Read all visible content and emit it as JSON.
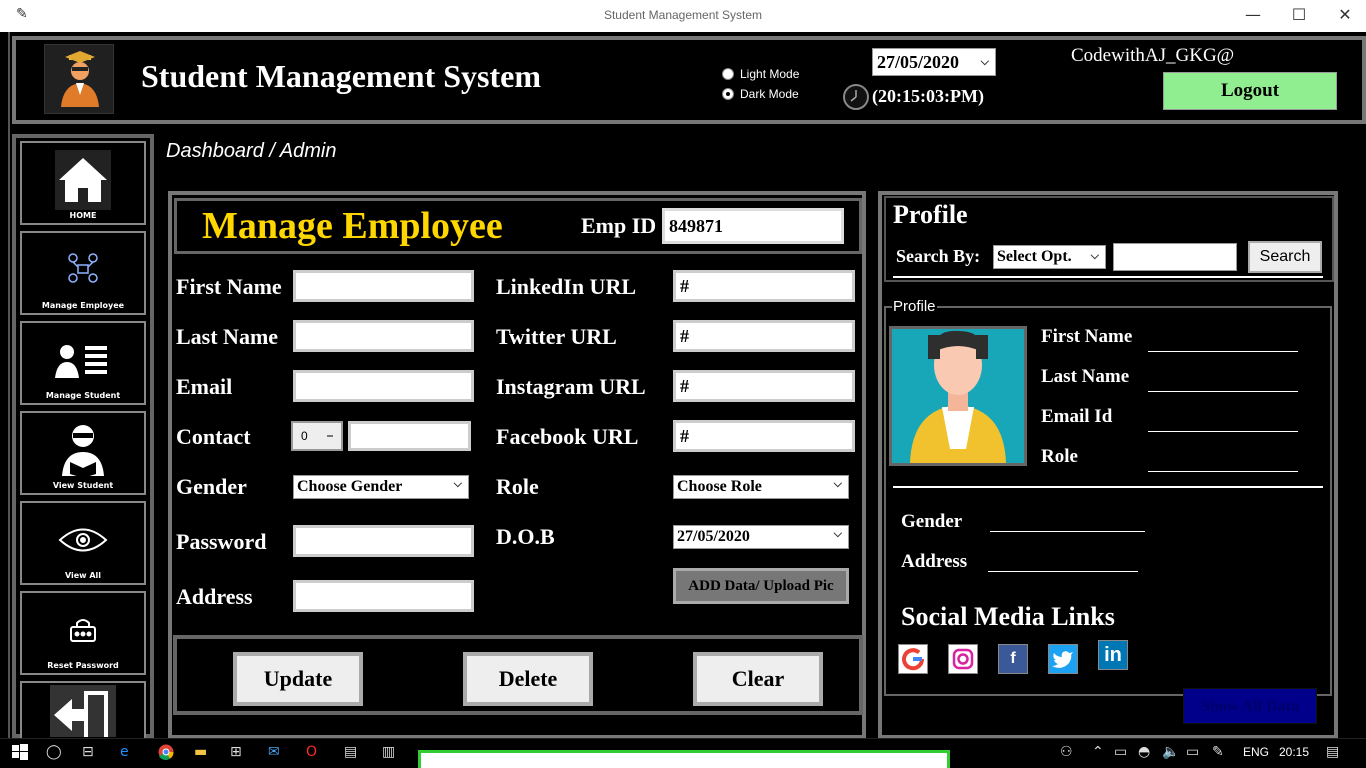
{
  "window": {
    "title": "Student Management System",
    "minimize": "—",
    "maximize": "☐",
    "close": "✕"
  },
  "header": {
    "app_title": "Student Management System",
    "light_mode": "Light Mode",
    "dark_mode": "Dark Mode",
    "selected_mode": "Dark Mode",
    "date": "27/05/2020",
    "time": "(20:15:03:PM)",
    "username": "CodewithAJ_GKG@",
    "logout": "Logout"
  },
  "sidebar": {
    "items": [
      {
        "label": "HOME",
        "icon": "home-icon"
      },
      {
        "label": "Manage Employee",
        "icon": "team-icon"
      },
      {
        "label": "Manage Student",
        "icon": "student-list-icon"
      },
      {
        "label": "View Student",
        "icon": "reader-icon"
      },
      {
        "label": "View All",
        "icon": "eye-icon"
      },
      {
        "label": "Reset Password",
        "icon": "lock-icon"
      },
      {
        "label": "",
        "icon": "exit-icon"
      }
    ]
  },
  "breadcrumb": "Dashboard / Admin",
  "manage_employee": {
    "title": "Manage Employee",
    "emp_id_label": "Emp ID",
    "emp_id_value": "849871",
    "first_name_label": "First Name",
    "last_name_label": "Last Name",
    "email_label": "Email",
    "contact_label": "Contact",
    "contact_code": "0",
    "gender_label": "Gender",
    "gender_value": "Choose Gender",
    "password_label": "Password",
    "address_label": "Address",
    "linkedin_label": "LinkedIn URL",
    "linkedin_value": "#",
    "twitter_label": "Twitter URL",
    "twitter_value": "#",
    "instagram_label": "Instagram URL",
    "instagram_value": "#",
    "facebook_label": "Facebook URL",
    "facebook_value": "#",
    "role_label": "Role",
    "role_value": "Choose Role",
    "dob_label": "D.O.B",
    "dob_value": "27/05/2020",
    "upload_button": "ADD Data/ Upload Pic",
    "update_button": "Update",
    "delete_button": "Delete",
    "clear_button": "Clear"
  },
  "profile": {
    "title": "Profile",
    "search_by_label": "Search By:",
    "search_select": "Select Opt.",
    "search_button": "Search",
    "frame_label": "Profile",
    "first_name": "First Name",
    "last_name": "Last Name",
    "email_id": "Email Id",
    "role": "Role",
    "gender": "Gender",
    "address": "Address",
    "social_title": "Social Media Links",
    "social_icons": [
      "google-icon",
      "instagram-icon",
      "facebook-icon",
      "twitter-icon",
      "linkedin-icon"
    ],
    "show_all": "Show All Data"
  },
  "taskbar": {
    "lang": "ENG",
    "time": "20:15"
  },
  "colors": {
    "title_accent": "#ffd700",
    "logout_bg": "#90ee90",
    "show_all_bg": "#00008b",
    "avatar_bg": "#17a7b8"
  }
}
